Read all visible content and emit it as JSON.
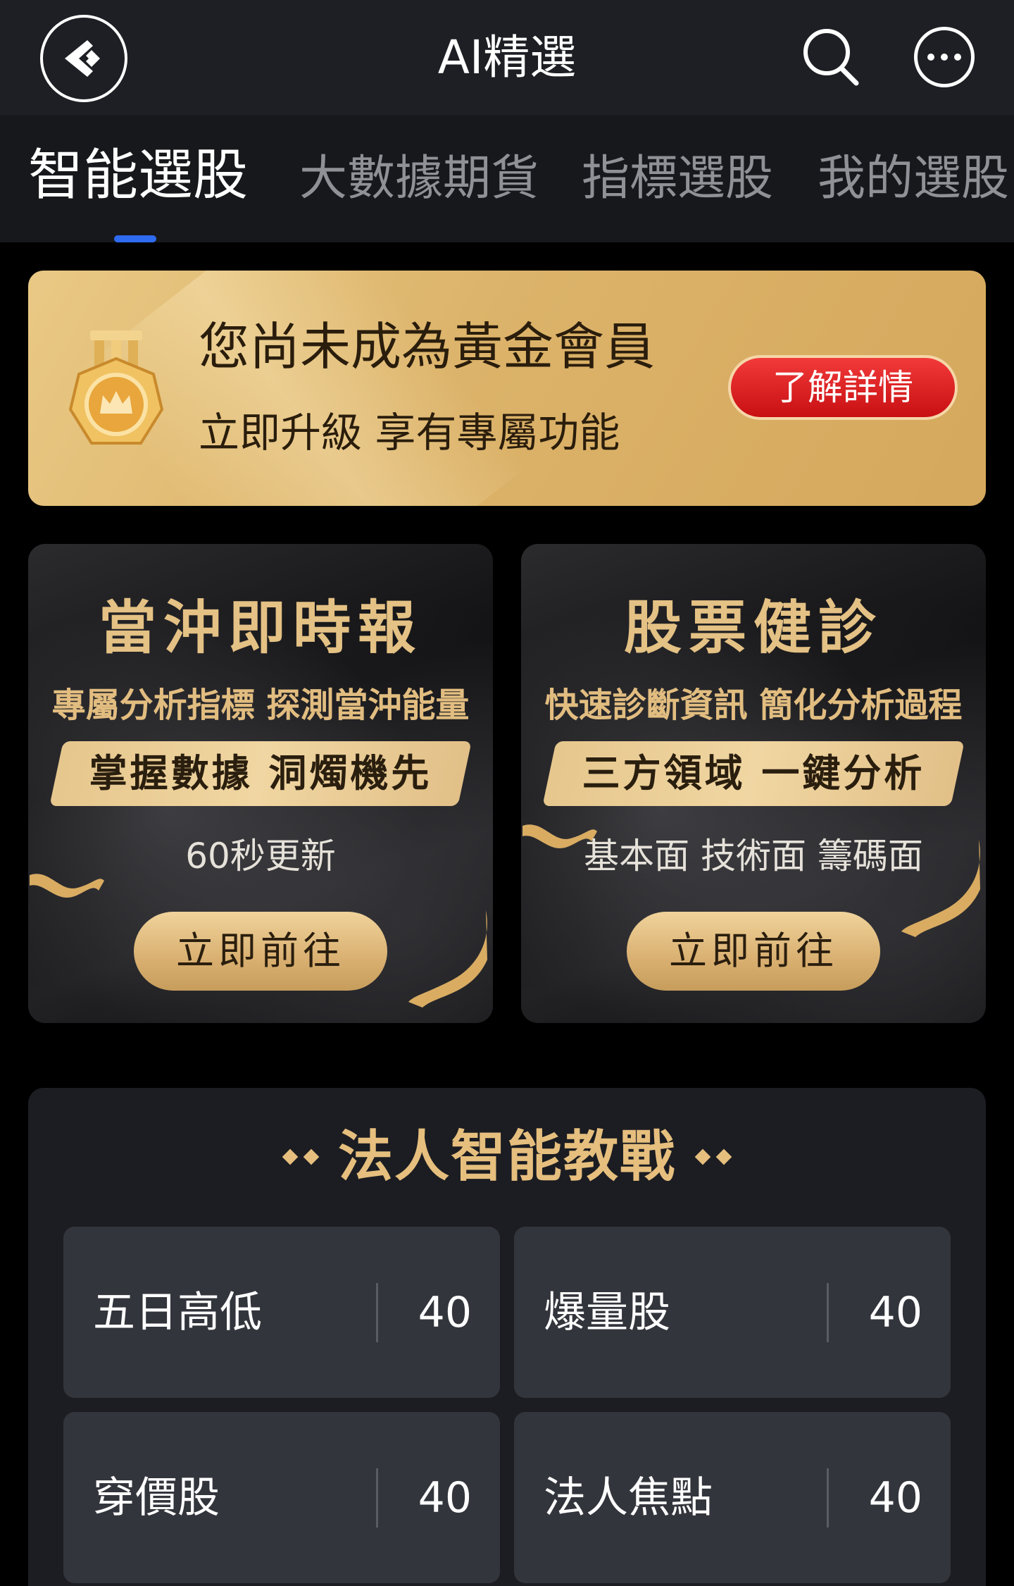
{
  "header": {
    "title": "AI精選",
    "back_icon": "back-arrow-icon",
    "search_icon": "search-icon",
    "more_icon": "more-dots-icon"
  },
  "tabs": [
    {
      "label": "智能選股",
      "active": true
    },
    {
      "label": "大數據期貨",
      "active": false
    },
    {
      "label": "指標選股",
      "active": false
    },
    {
      "label": "我的選股",
      "active": false
    }
  ],
  "gold_banner": {
    "title": "您尚未成為黃金會員",
    "subtitle": "立即升級 享有專屬功能",
    "button_label": "了解詳情",
    "icon": "gold-medal-icon"
  },
  "promos": [
    {
      "title": "當沖即時報",
      "description": "專屬分析指標 探測當沖能量",
      "ribbon": "掌握數據 洞燭機先",
      "note": "60秒更新",
      "button_label": "立即前往"
    },
    {
      "title": "股票健診",
      "description": "快速診斷資訊 簡化分析過程",
      "ribbon": "三方領域 一鍵分析",
      "note": "基本面 技術面 籌碼面",
      "button_label": "立即前往"
    }
  ],
  "section": {
    "title": "法人智能教戰",
    "items": [
      {
        "name": "五日高低",
        "count": "40"
      },
      {
        "name": "爆量股",
        "count": "40"
      },
      {
        "name": "穿價股",
        "count": "40"
      },
      {
        "name": "法人焦點",
        "count": "40"
      }
    ]
  },
  "colors": {
    "header_bg": "#1e1f24",
    "tab_indicator": "#2f6bf0",
    "gold_text": "#e6bf7e",
    "detail_button": "#d9191c",
    "card_bg": "#33353c"
  }
}
